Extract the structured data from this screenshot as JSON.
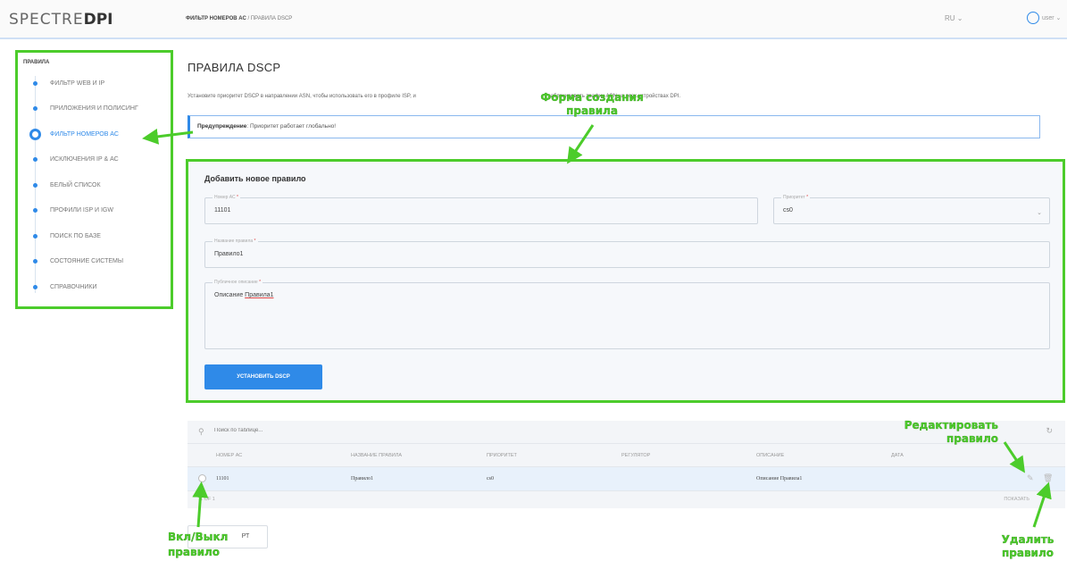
{
  "header": {
    "logo_light": "SPECTRE",
    "logo_bold": "DPI",
    "breadcrumb_current": "ФИЛЬТР НОМЕРОВ АС",
    "breadcrumb_rest": " / ПРАВИЛА DSCP",
    "lang": "RU ⌄",
    "user": "user ⌄"
  },
  "sidebar": {
    "title": "ПРАВИЛА",
    "items": [
      {
        "label": "ФИЛЬТР WEB И IP"
      },
      {
        "label": "ПРИЛОЖЕНИЯ И ПОЛИСИНГ"
      },
      {
        "label": "ФИЛЬТР НОМЕРОВ АС"
      },
      {
        "label": "ИСКЛЮЧЕНИЯ IP & АС"
      },
      {
        "label": "БЕЛЫЙ СПИСОК"
      },
      {
        "label": "ПРОФИЛИ ISP И IGW"
      },
      {
        "label": "ПОИСК ПО БАЗЕ"
      },
      {
        "label": "СОСТОЯНИЕ СИСТЕМЫ"
      },
      {
        "label": "СПРАВОЧНИКИ"
      }
    ],
    "active_index": 2
  },
  "main": {
    "title": "ПРАВИЛА DSCP",
    "description": "Установите приоритет DSCP в направлении ASN, чтобы использовать его в профиле ISP, и",
    "description_tail": "заблокировать трафик ASN на всех устройствах DPI.",
    "warning_label": "Предупреждение",
    "warning_text": ": Приоритет работает глобально!"
  },
  "form": {
    "title": "Добавить новое правило",
    "asn_label": "Номер АС",
    "asn_value": "11101",
    "priority_label": "Приоритет",
    "priority_value": "cs0",
    "name_label": "Название правила",
    "name_value": "Правило1",
    "desc_label": "Публичное описание",
    "desc_prefix": "Описание ",
    "desc_word": "Правила1",
    "required_mark": "*",
    "submit": "УСТАНОВИТЬ DSCP"
  },
  "table": {
    "search_placeholder": "Поиск по таблице...",
    "columns": [
      "НОМЕР АС",
      "НАЗВАНИЕ ПРАВИЛА",
      "ПРИОРИТЕТ",
      "РЕГУЛЯТОР",
      "ОПИСАНИЕ",
      "ДАТА"
    ],
    "rows": [
      {
        "asn": "11101",
        "name": "Правило1",
        "priority": "cs0",
        "regulator": "",
        "description": "Описание Правила1",
        "date": ""
      }
    ],
    "count": "1 OF 1",
    "show": "ПОКАЗАТЬ",
    "export_tail": "РТ"
  },
  "annotations": {
    "form": "Форма создания\nправила",
    "edit": "Редактировать\nправило",
    "toggle": "Вкл/Выкл",
    "toggle2": "правило",
    "delete": "Удалить\nправило"
  },
  "colors": {
    "accent": "#2f8ae8",
    "annotation": "#4ccc2b",
    "required": "#e04545"
  }
}
